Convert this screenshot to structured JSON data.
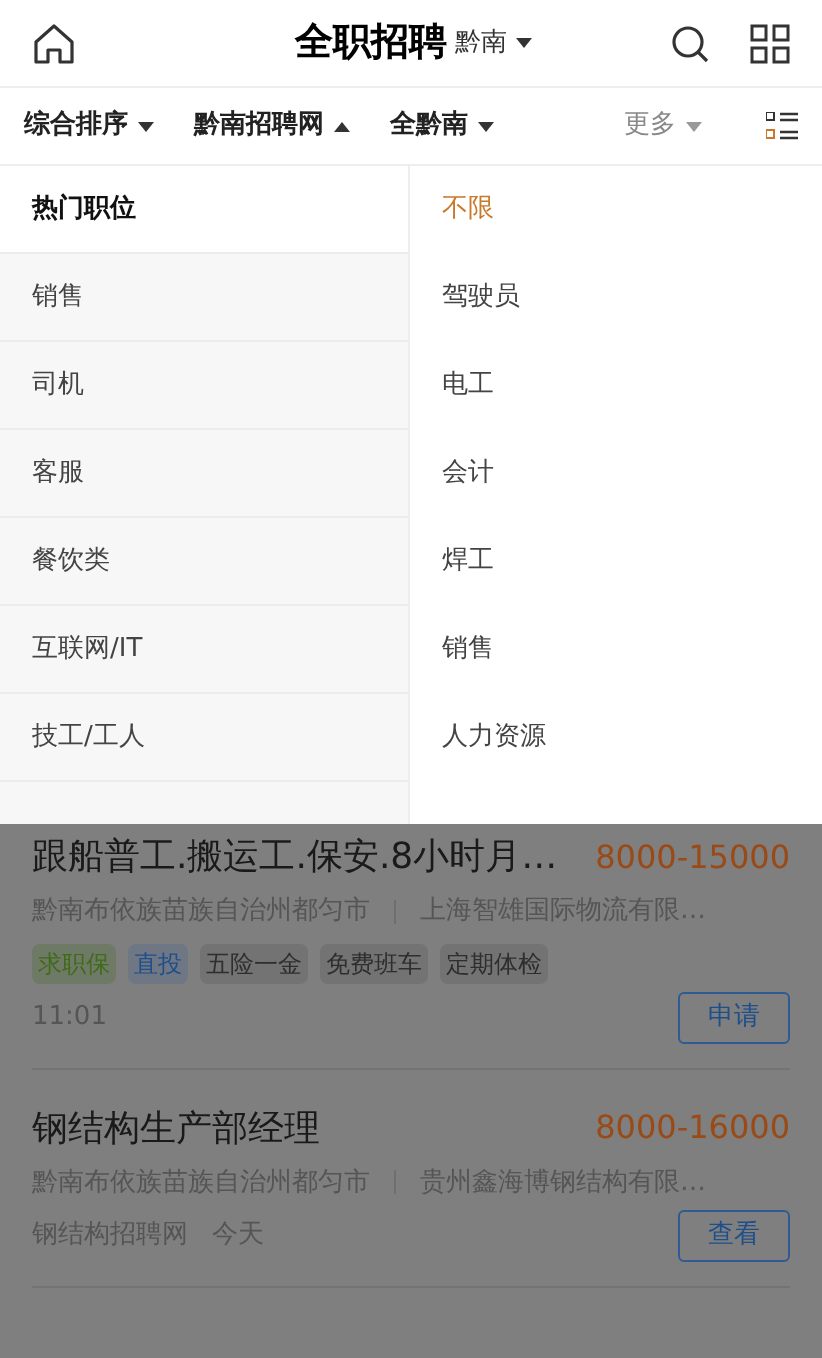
{
  "header": {
    "title": "全职招聘",
    "city": "黔南"
  },
  "filters": [
    {
      "label": "综合排序",
      "expanded": false,
      "muted": false
    },
    {
      "label": "黔南招聘网",
      "expanded": true,
      "muted": false
    },
    {
      "label": "全黔南",
      "expanded": false,
      "muted": false
    },
    {
      "label": "更多",
      "expanded": false,
      "muted": true
    }
  ],
  "categories": [
    {
      "label": "热门职位",
      "selected": true
    },
    {
      "label": "销售",
      "selected": false
    },
    {
      "label": "司机",
      "selected": false
    },
    {
      "label": "客服",
      "selected": false
    },
    {
      "label": "餐饮类",
      "selected": false
    },
    {
      "label": "互联网/IT",
      "selected": false
    },
    {
      "label": "技工/工人",
      "selected": false
    }
  ],
  "positions": [
    {
      "label": "不限",
      "selected": true
    },
    {
      "label": "驾驶员",
      "selected": false
    },
    {
      "label": "电工",
      "selected": false
    },
    {
      "label": "会计",
      "selected": false
    },
    {
      "label": "焊工",
      "selected": false
    },
    {
      "label": "销售",
      "selected": false
    },
    {
      "label": "人力资源",
      "selected": false
    }
  ],
  "jobs": [
    {
      "title": "跟船普工.搬运工.保安.8小时月…",
      "salary": "8000-15000",
      "location": "黔南布依族苗族自治州都匀市",
      "company": "上海智雄国际物流有限…",
      "tags": [
        {
          "label": "求职保",
          "kind": "guarantee"
        },
        {
          "label": "直投",
          "kind": "direct"
        },
        {
          "label": "五险一金",
          "kind": "benefit"
        },
        {
          "label": "免费班车",
          "kind": "benefit"
        },
        {
          "label": "定期体检",
          "kind": "benefit"
        }
      ],
      "meta": [
        "11:01"
      ],
      "action": "申请"
    },
    {
      "title": "钢结构生产部经理",
      "salary": "8000-16000",
      "location": "黔南布依族苗族自治州都匀市",
      "company": "贵州鑫海博钢结构有限…",
      "meta": [
        "钢结构招聘网",
        "今天"
      ],
      "action": "查看"
    }
  ]
}
